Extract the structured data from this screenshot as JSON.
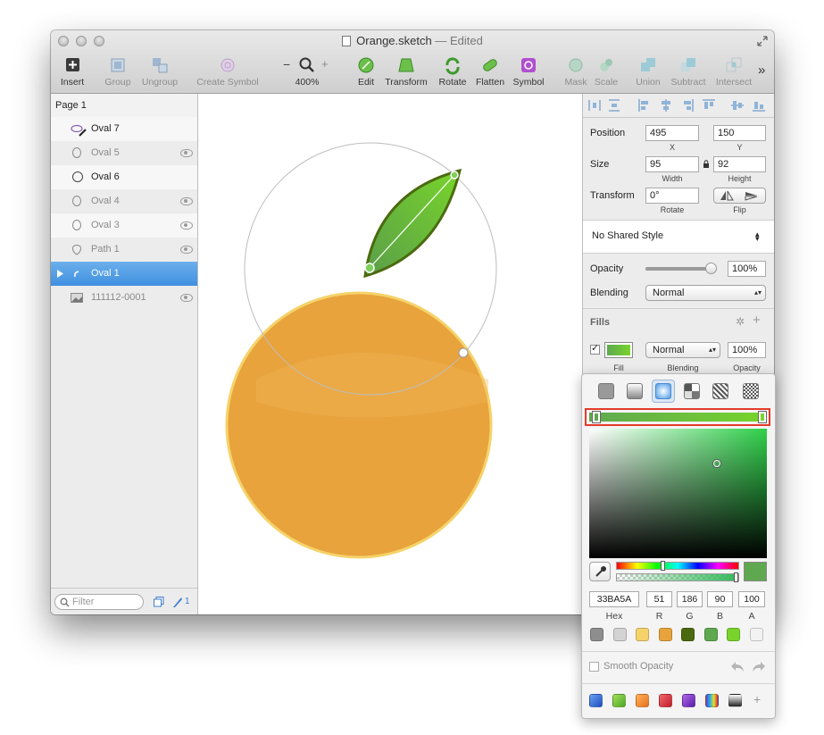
{
  "window": {
    "title": "Orange.sketch",
    "edited": "— Edited"
  },
  "toolbar": {
    "insert": "Insert",
    "group": "Group",
    "ungroup": "Ungroup",
    "create_symbol": "Create Symbol",
    "zoom_minus": "−",
    "zoom_plus": "+",
    "zoom": "400%",
    "edit": "Edit",
    "transform": "Transform",
    "rotate": "Rotate",
    "flatten": "Flatten",
    "symbol": "Symbol",
    "mask": "Mask",
    "scale": "Scale",
    "union": "Union",
    "subtract": "Subtract",
    "intersect": "Intersect",
    "overflow": "»"
  },
  "sidebar": {
    "page": "Page 1",
    "layers": [
      {
        "name": "Oval 7",
        "hidden": false
      },
      {
        "name": "Oval 5",
        "hidden": true
      },
      {
        "name": "Oval 6",
        "hidden": false
      },
      {
        "name": "Oval 4",
        "hidden": true
      },
      {
        "name": "Oval 3",
        "hidden": true
      },
      {
        "name": "Path 1",
        "hidden": true
      },
      {
        "name": "Oval 1",
        "hidden": false
      },
      {
        "name": "111112-0001",
        "hidden": true
      }
    ],
    "filter_placeholder": "Filter",
    "selected_count": "1"
  },
  "inspector": {
    "position_label": "Position",
    "x": "495",
    "y": "150",
    "x_label": "X",
    "y_label": "Y",
    "size_label": "Size",
    "width": "95",
    "height": "92",
    "width_label": "Width",
    "height_label": "Height",
    "transform_label": "Transform",
    "rotate": "0°",
    "rotate_label": "Rotate",
    "flip_label": "Flip",
    "shared_style": "No Shared Style",
    "opacity_label": "Opacity",
    "opacity": "100%",
    "opacity_level": 1.0,
    "blending_label": "Blending",
    "blending": "Normal",
    "fills_label": "Fills",
    "fill_blending": "Normal",
    "fill_opacity": "100%",
    "fill_sub_fill": "Fill",
    "fill_sub_blending": "Blending",
    "fill_sub_opacity": "Opacity"
  },
  "color_picker": {
    "hex": "33BA5A",
    "r": "51",
    "g": "186",
    "b": "90",
    "a": "100",
    "hex_label": "Hex",
    "r_label": "R",
    "g_label": "G",
    "b_label": "B",
    "a_label": "A",
    "smooth_opacity": "Smooth Opacity",
    "doc_colors": [
      "#8e8e8e",
      "#d3d3d3",
      "#f5d36a",
      "#e8a33c",
      "#4b6a10",
      "#5fa850",
      "#78d42b",
      "#f2f2f2"
    ],
    "presets": [
      "gradient-blue",
      "gradient-green",
      "gradient-orange",
      "gradient-red",
      "gradient-purple",
      "gradient-rainbow",
      "gradient-gray"
    ]
  },
  "colors": {
    "accent": "#3f8fe0",
    "orange": "#e8a33c",
    "orange_border": "#f5d36a",
    "leaf": "#5fa850",
    "leaf_border": "#4b6a10"
  }
}
